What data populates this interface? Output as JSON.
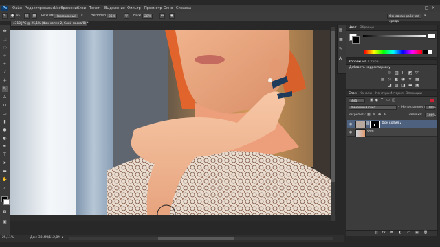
{
  "app": {
    "logo": "Ps",
    "workspace": "Основная рабочая среда"
  },
  "menu": [
    {
      "label": "Файл"
    },
    {
      "label": "Редактирование"
    },
    {
      "label": "Изображение"
    },
    {
      "label": "Слои"
    },
    {
      "label": "Текст"
    },
    {
      "label": "Выделение"
    },
    {
      "label": "Фильтр"
    },
    {
      "label": "Просмотр"
    },
    {
      "label": "Окно"
    },
    {
      "label": "Справка"
    }
  ],
  "options": {
    "brush_size": "85",
    "mode_label": "Режим:",
    "mode_value": "Нормальный",
    "opacity_label": "Непрозр.:",
    "opacity_value": "35%",
    "flow_label": "Наж.:",
    "flow_value": "28%"
  },
  "document": {
    "tab_title": "4310.JPG @ 25,1% (Фон копия 2, Слой-маска/8) *",
    "zoom": "25,11%",
    "doc_info": "Док: 33,4M/112,8M"
  },
  "color_panel": {
    "tabs": [
      {
        "label": "Цвет",
        "active": true
      },
      {
        "label": "Образцы",
        "active": false
      }
    ]
  },
  "adjustments_panel": {
    "tabs": [
      {
        "label": "Коррекция",
        "active": true
      },
      {
        "label": "Стили",
        "active": false
      }
    ],
    "title": "Добавить корректировку"
  },
  "layers_panel": {
    "tabs": [
      {
        "label": "Слои",
        "active": true
      },
      {
        "label": "Каналы",
        "active": false
      },
      {
        "label": "Контуры",
        "active": false
      },
      {
        "label": "История",
        "active": false
      },
      {
        "label": "Операции",
        "active": false
      }
    ],
    "filter_label": "Вид",
    "blend_mode": "Линейный свет",
    "opacity_label": "Непрозрачность:",
    "opacity_value": "100%",
    "lock_label": "Закрепить:",
    "fill_label": "Заливка:",
    "fill_value": "100%",
    "layers": [
      {
        "name": "Фон копия 2",
        "selected": true
      },
      {
        "name": "Фон",
        "selected": false
      }
    ]
  },
  "colors": {
    "accent": "#3b5f8a",
    "selected_row": "#4e6280"
  }
}
